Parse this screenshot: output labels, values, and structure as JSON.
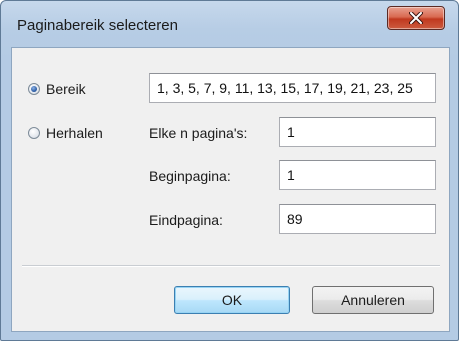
{
  "window": {
    "title": "Paginabereik selecteren"
  },
  "range_option": {
    "label": "Bereik",
    "checked": true,
    "value": "1, 3, 5, 7, 9, 11, 13, 15, 17, 19, 21, 23, 25"
  },
  "repeat_option": {
    "label": "Herhalen",
    "checked": false
  },
  "every_n": {
    "label": "Elke n pagina's:",
    "value": "1"
  },
  "start_page": {
    "label": "Beginpagina:",
    "value": "1"
  },
  "end_page": {
    "label": "Eindpagina:",
    "value": "89"
  },
  "buttons": {
    "ok": "OK",
    "cancel": "Annuleren"
  },
  "icons": {
    "close": "close-x-icon",
    "radio_checked": "radio-checked-icon",
    "radio_unchecked": "radio-unchecked-icon"
  },
  "colors": {
    "titlebar": "#b7cde5",
    "close_button": "#c0391f",
    "default_button_border": "#3c7fb1",
    "dialog_background": "#f0f0f0"
  }
}
